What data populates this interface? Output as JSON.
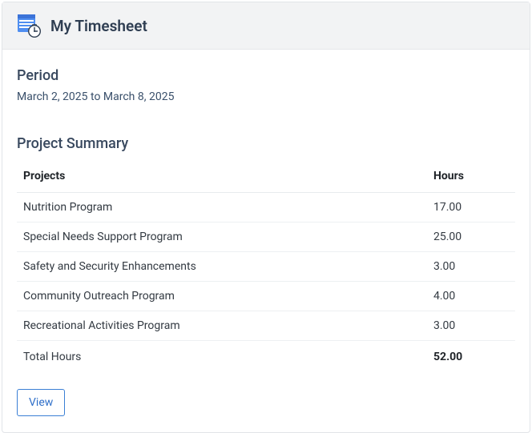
{
  "header": {
    "title": "My Timesheet"
  },
  "period": {
    "label": "Period",
    "value": "March 2, 2025 to March 8, 2025"
  },
  "summary": {
    "heading": "Project Summary",
    "columns": {
      "projects": "Projects",
      "hours": "Hours"
    },
    "rows": [
      {
        "name": "Nutrition Program",
        "hours": "17.00"
      },
      {
        "name": "Special Needs Support Program",
        "hours": "25.00"
      },
      {
        "name": "Safety and Security Enhancements",
        "hours": "3.00"
      },
      {
        "name": "Community Outreach Program",
        "hours": "4.00"
      },
      {
        "name": "Recreational Activities Program",
        "hours": "3.00"
      }
    ],
    "total_label": "Total Hours",
    "total_hours": "52.00"
  },
  "actions": {
    "view": "View"
  }
}
